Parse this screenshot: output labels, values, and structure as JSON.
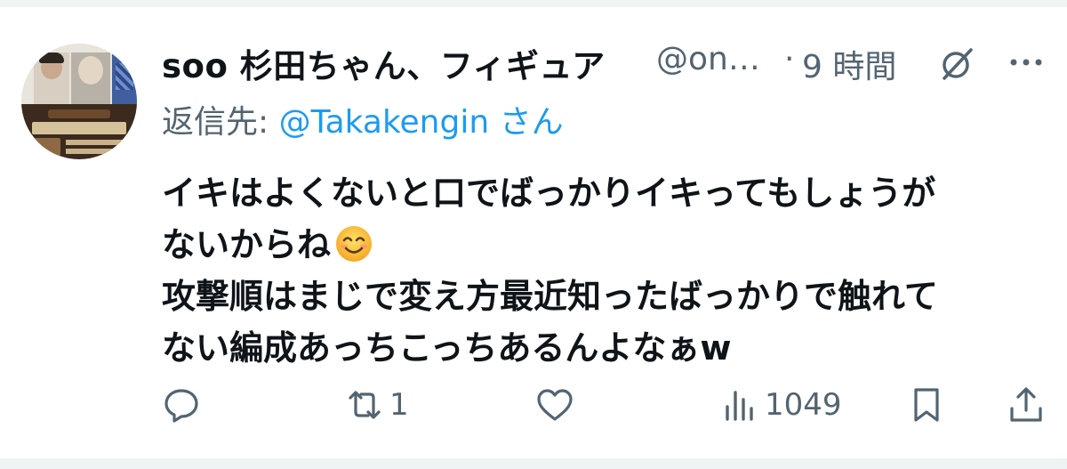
{
  "tweet": {
    "display_name": "soo 杉田ちゃん、フィギュア",
    "handle": "@on…",
    "separator": "·",
    "time": "9 時間",
    "reply_label": "返信先: ",
    "reply_target": "@Takakengin さん",
    "body_lines": [
      "イキはよくないと口でばっかりイキってもしょうが",
      "ないからね",
      "攻撃順はまじで変え方最近知ったばっかりで触れて",
      "ない編成あっちこっちあるんよなぁw"
    ],
    "emoji": "smiling-face-emoji"
  },
  "actions": {
    "reply_count": "",
    "retweet_count": "1",
    "like_count": "",
    "views_count": "1049"
  },
  "icons": {
    "grok": "grok-icon",
    "more": "more-options-icon",
    "reply": "reply-icon",
    "retweet": "retweet-icon",
    "like": "heart-icon",
    "views": "views-icon",
    "bookmark": "bookmark-icon",
    "share": "share-icon"
  },
  "colors": {
    "text": "#0f1419",
    "secondary": "#536471",
    "link": "#1d9bf0",
    "divider": "#eff3f4"
  }
}
